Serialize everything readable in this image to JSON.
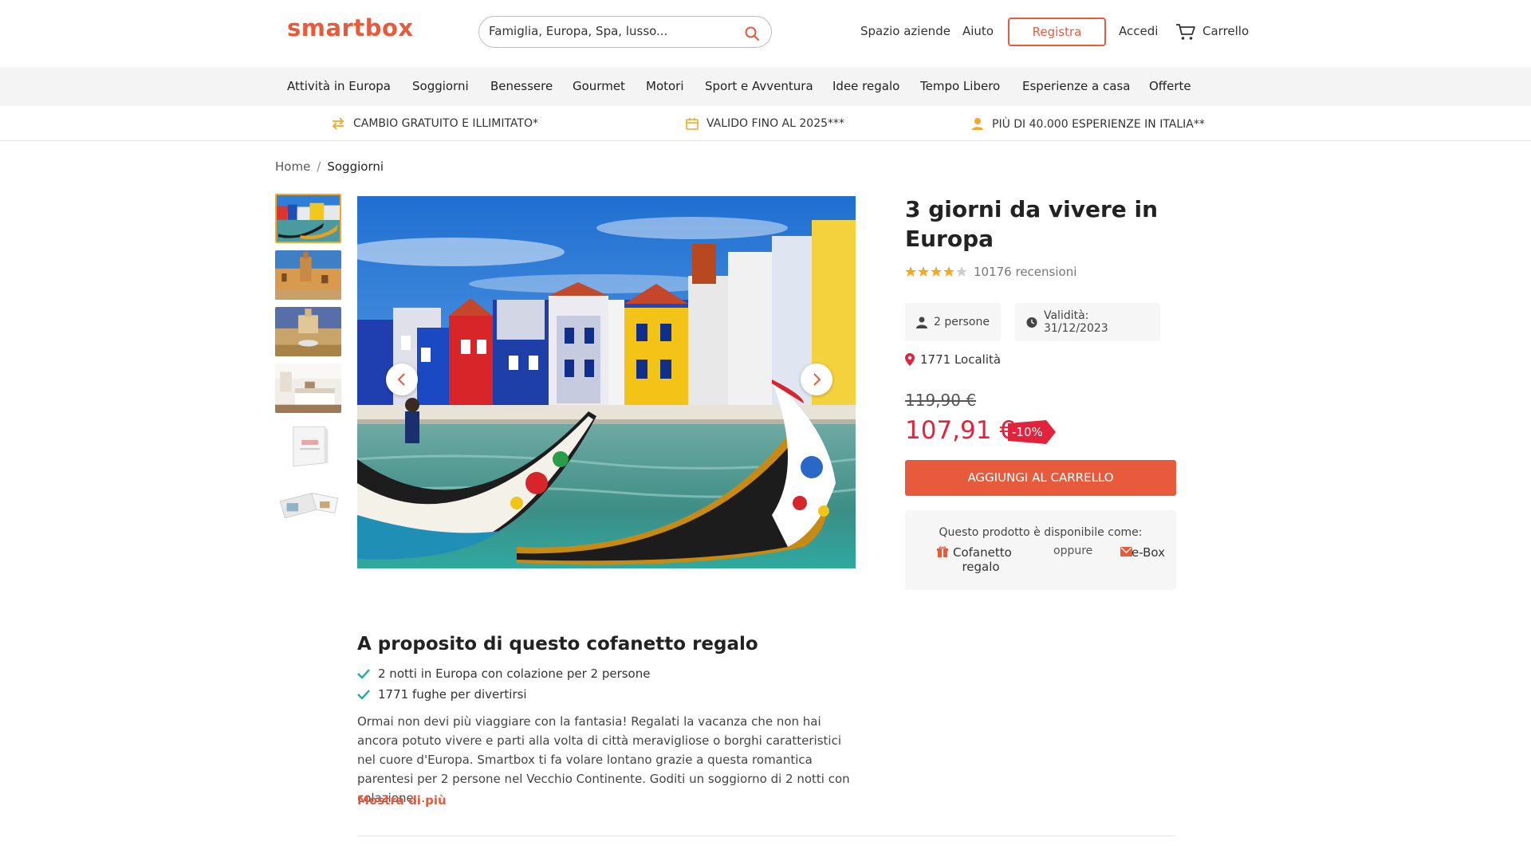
{
  "header": {
    "logo": "smartbox",
    "search_placeholder": "Famiglia, Europa, Spa, lusso...",
    "links": {
      "business": "Spazio aziende",
      "help": "Aiuto",
      "register": "Registra",
      "login": "Accedi",
      "cart": "Carrello"
    }
  },
  "nav": {
    "items": [
      "Attività in Europa",
      "Soggiorni",
      "Benessere",
      "Gourmet",
      "Motori",
      "Sport e Avventura",
      "Idee regalo",
      "Tempo Libero",
      "Esperienze a casa",
      "Offerte"
    ]
  },
  "benefits": [
    {
      "icon": "exchange-arrows-icon",
      "text": "CAMBIO GRATUITO E ILLIMITATO*"
    },
    {
      "icon": "calendar-icon",
      "text": "VALIDO FINO AL 2025***"
    },
    {
      "icon": "person-icon",
      "text": "PIÙ DI 40.000 ESPERIENZE IN ITALIA**"
    }
  ],
  "breadcrumb": {
    "home": "Home",
    "current": "Soggiorni"
  },
  "gallery": {
    "thumbnails": [
      "canal-boats",
      "city-square",
      "fountain-palace",
      "bedroom",
      "gift-box",
      "booklet"
    ],
    "active_index": 0
  },
  "product": {
    "title": "3 giorni da vivere in Europa",
    "rating": 4,
    "rating_max": 5,
    "reviews": "10176 recensioni",
    "persons": "2 persone",
    "validity": "Validità: 31/12/2023",
    "locations": "1771 Località",
    "old_price": "119,90 €",
    "new_price": "107,91 €",
    "discount": "-10%",
    "add_to_cart": "AGGIUNGI AL CARRELLO",
    "availability": {
      "title": "Questo prodotto è disponibile come:",
      "option1": "Cofanetto regalo",
      "or": "oppure",
      "option2": "e-Box"
    }
  },
  "about": {
    "title": "A proposito di questo cofanetto regalo",
    "features": [
      "2 notti in Europa con colazione per 2 persone",
      "1771 fughe per divertirsi"
    ],
    "description": "Ormai non devi più viaggiare con la fantasia! Regalati la vacanza che non hai ancora potuto vivere e parti alla volta di città meravigliose o borghi caratteristici nel cuore d'Europa. Smartbox ti fa volare lontano grazie a questa romantica parentesi per 2 persone nel Vecchio Continente. Goditi un soggiorno di 2 notti con colazione...",
    "more": "Mostra di più"
  },
  "colors": {
    "brand": "#e85a3c",
    "price": "#e2233b",
    "star": "#f5a623",
    "check": "#1aae9f"
  }
}
